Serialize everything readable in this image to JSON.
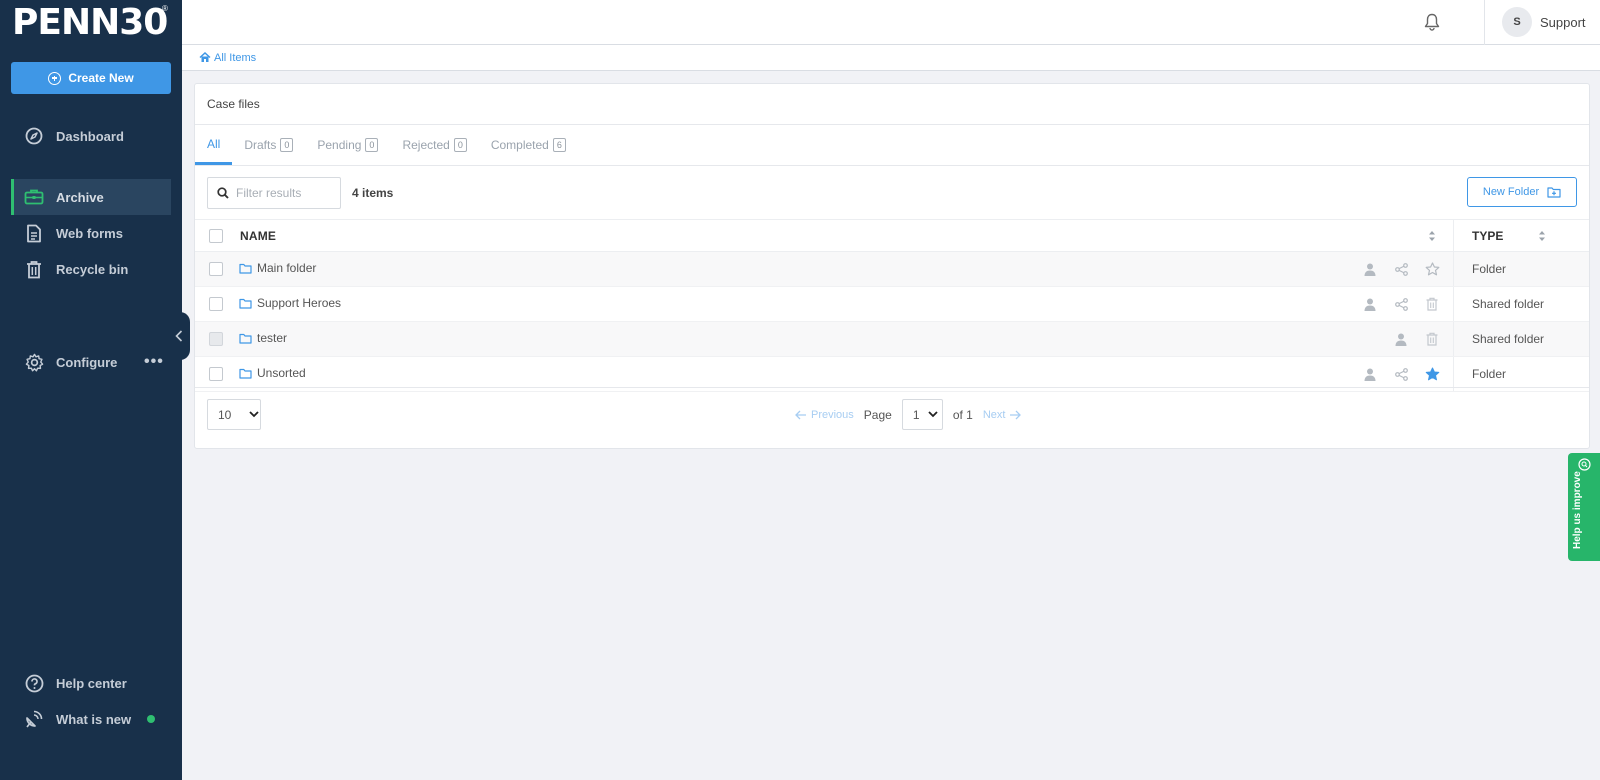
{
  "brand": {
    "logo_text": "PENN30",
    "logo_mark": "®"
  },
  "sidebar": {
    "create_label": "Create New",
    "items": [
      {
        "label": "Dashboard",
        "icon": "compass-icon"
      },
      {
        "label": "Archive",
        "icon": "briefcase-icon",
        "active": true
      },
      {
        "label": "Web forms",
        "icon": "document-icon"
      },
      {
        "label": "Recycle bin",
        "icon": "trash-icon"
      },
      {
        "label": "Configure",
        "icon": "gear-icon"
      },
      {
        "label": "Help center",
        "icon": "question-icon"
      },
      {
        "label": "What is new",
        "icon": "satellite-icon"
      }
    ],
    "configure_more": "•••"
  },
  "topbar": {
    "user_initial": "S",
    "user_name": "Support"
  },
  "breadcrumb": {
    "label": "All Items"
  },
  "card": {
    "title": "Case files",
    "tabs": [
      {
        "label": "All",
        "count": null
      },
      {
        "label": "Drafts",
        "count": "0"
      },
      {
        "label": "Pending",
        "count": "0"
      },
      {
        "label": "Rejected",
        "count": "0"
      },
      {
        "label": "Completed",
        "count": "6"
      }
    ],
    "filter_placeholder": "Filter results",
    "item_count": "4 items",
    "new_folder_label": "New Folder",
    "columns": {
      "name": "NAME",
      "type": "TYPE"
    },
    "rows": [
      {
        "name": "Main folder",
        "type": "Folder",
        "icons": [
          "person-icon",
          "share-icon",
          "star-outline-icon"
        ]
      },
      {
        "name": "Support Heroes",
        "type": "Shared folder",
        "icons": [
          "person-icon",
          "share-icon",
          "trash-icon"
        ]
      },
      {
        "name": "tester",
        "type": "Shared folder",
        "icons": [
          "person-icon",
          "trash-icon"
        ]
      },
      {
        "name": "Unsorted",
        "type": "Folder",
        "icons": [
          "person-icon",
          "share-icon",
          "star-filled-icon"
        ]
      }
    ],
    "pagination": {
      "per_page": "10",
      "previous": "Previous",
      "page_label": "Page",
      "current_page": "1",
      "of_label": "of 1",
      "next": "Next"
    }
  },
  "feedback": {
    "label": "Help us improve"
  },
  "colors": {
    "sidebar_bg": "#18304a",
    "accent": "#3f97e6",
    "active_marker": "#2fbf71",
    "feedback_bg": "#27b56a"
  }
}
